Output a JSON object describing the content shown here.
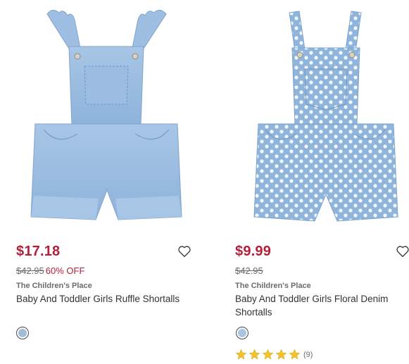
{
  "products": [
    {
      "price": "$17.18",
      "original_price": "$42.95",
      "discount": "60% OFF",
      "brand": "The Children's Place",
      "name": "Baby And Toddler Girls Ruffle Shortalls",
      "swatch_color": "#9fbcd8",
      "image_icon": "ruffle-shortalls-image"
    },
    {
      "price": "$9.99",
      "original_price": "$42.95",
      "brand": "The Children's Place",
      "name": "Baby And Toddler Girls Floral Denim Shortalls",
      "swatch_color": "#a9c6e2",
      "rating": 5,
      "review_count": "(9)",
      "image_icon": "floral-shortalls-image"
    }
  ],
  "colors": {
    "sale": "#b3203b",
    "star": "#f2c230",
    "denim": "#8fb5dc"
  }
}
